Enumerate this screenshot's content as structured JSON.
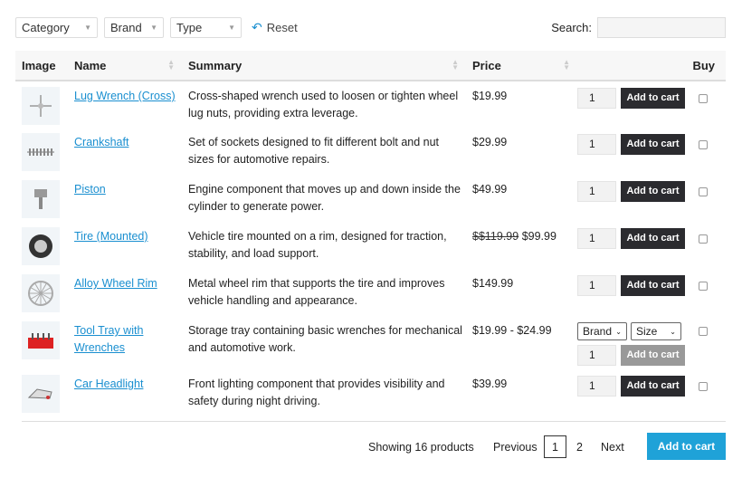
{
  "filters": {
    "category": "Category",
    "brand": "Brand",
    "type": "Type",
    "reset": "Reset"
  },
  "search": {
    "label": "Search:",
    "value": ""
  },
  "columns": {
    "image": "Image",
    "name": "Name",
    "summary": "Summary",
    "price": "Price",
    "buy": "Buy"
  },
  "products": [
    {
      "name": "Lug Wrench (Cross)",
      "summary": "Cross-shaped wrench used to loosen or tighten wheel lug nuts, providing extra leverage.",
      "price": "$19.99",
      "qty": "1",
      "cart": "Add to cart"
    },
    {
      "name": "Crankshaft",
      "summary": "Set of sockets designed to fit different bolt and nut sizes for automotive repairs.",
      "price": "$29.99",
      "qty": "1",
      "cart": "Add to cart"
    },
    {
      "name": "Piston",
      "summary": "Engine component that moves up and down inside the cylinder to generate power.",
      "price": "$49.99",
      "qty": "1",
      "cart": "Add to cart"
    },
    {
      "name": "Tire (Mounted)",
      "summary": "Vehicle tire mounted on a rim, designed for traction, stability, and load support.",
      "old_price": "$$119.99",
      "price": "$99.99",
      "qty": "1",
      "cart": "Add to cart"
    },
    {
      "name": "Alloy Wheel Rim",
      "summary": "Metal wheel rim that supports the tire and improves vehicle handling and appearance.",
      "price": "$149.99",
      "qty": "1",
      "cart": "Add to cart"
    },
    {
      "name": "Tool Tray with Wrenches",
      "summary": "Storage tray containing basic wrenches for mechanical and automotive work.",
      "price": "$19.99 - $24.99",
      "variant_brand": "Brand",
      "variant_size": "Size",
      "qty": "1",
      "cart": "Add to cart"
    },
    {
      "name": "Car Headlight",
      "summary": "Front lighting component that provides visibility and safety during night driving.",
      "price": "$39.99",
      "qty": "1",
      "cart": "Add to cart"
    }
  ],
  "footer": {
    "showing": "Showing 16 products",
    "previous": "Previous",
    "page1": "1",
    "page2": "2",
    "next": "Next",
    "add_all": "Add to cart"
  }
}
